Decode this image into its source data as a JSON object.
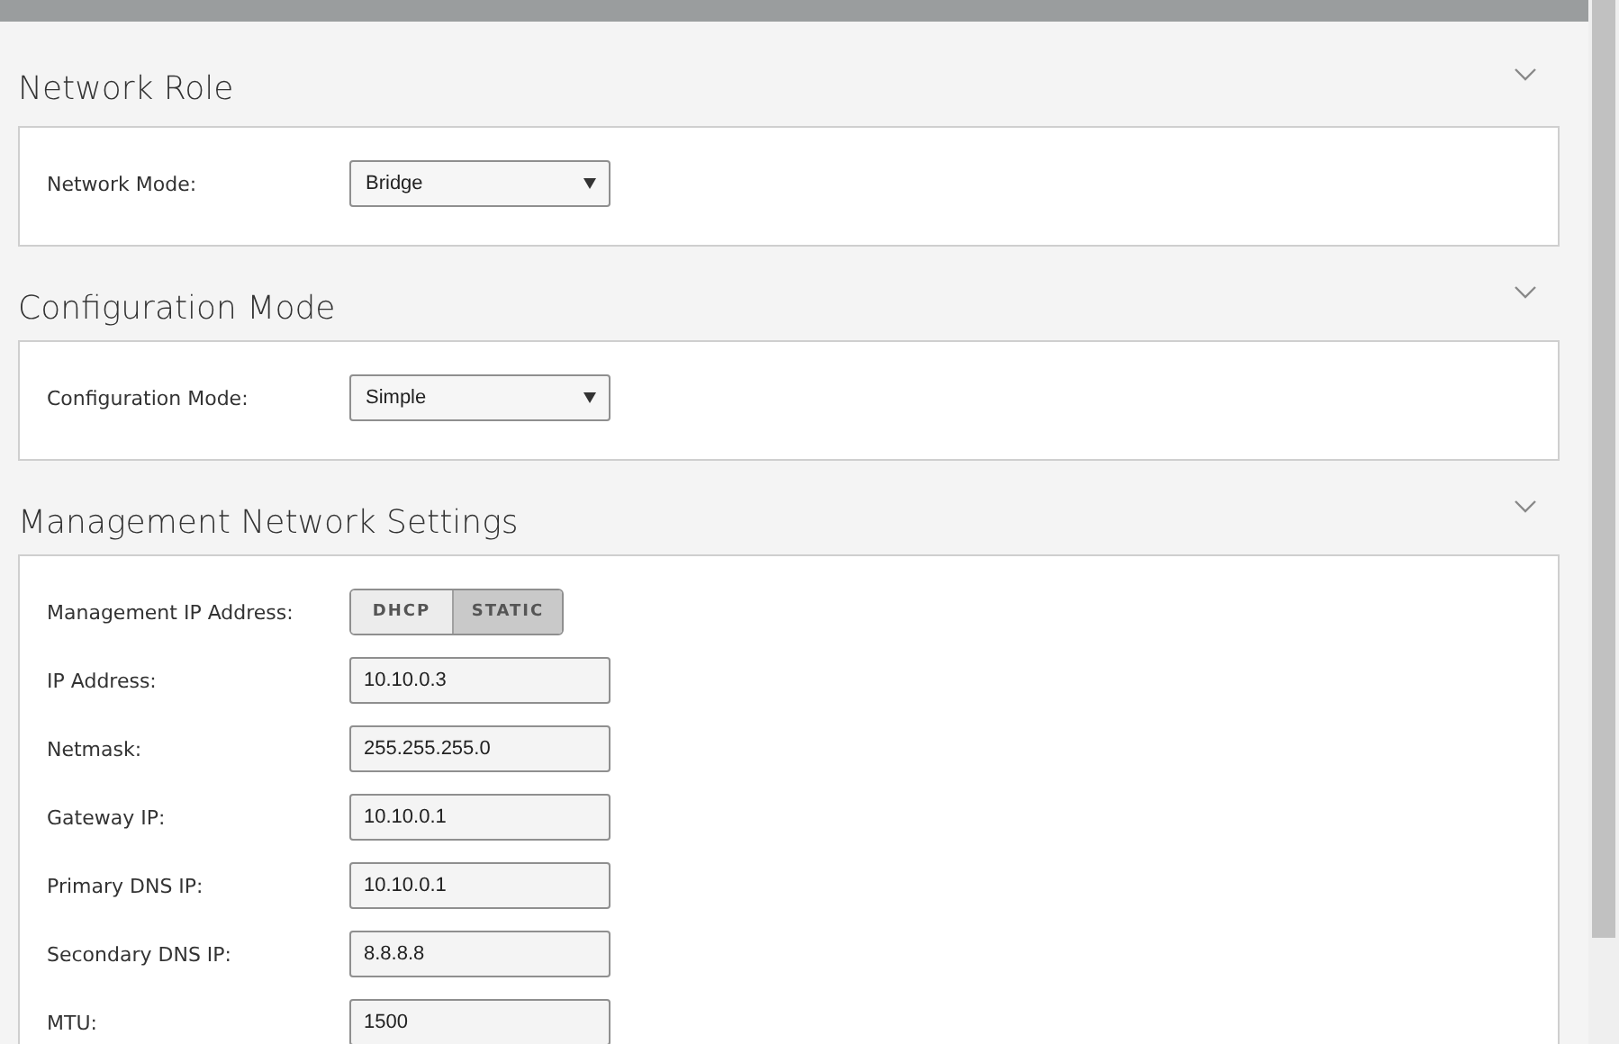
{
  "sections": [
    {
      "title": "Network Role",
      "rows": [
        {
          "kind": "select",
          "label": "Network Mode:",
          "value": "Bridge"
        }
      ]
    },
    {
      "title": "Configuration Mode",
      "rows": [
        {
          "kind": "select",
          "label": "Configuration Mode:",
          "value": "Simple"
        }
      ]
    },
    {
      "title": "Management Network Settings",
      "rows": [
        {
          "kind": "toggle",
          "label": "Management IP Address:",
          "options": [
            {
              "label": "DHCP",
              "selected": false
            },
            {
              "label": "STATIC",
              "selected": true
            }
          ]
        },
        {
          "kind": "text",
          "label": "IP Address:",
          "value": "10.10.0.3"
        },
        {
          "kind": "text",
          "label": "Netmask:",
          "value": "255.255.255.0"
        },
        {
          "kind": "text",
          "label": "Gateway IP:",
          "value": "10.10.0.1"
        },
        {
          "kind": "text",
          "label": "Primary DNS IP:",
          "value": "10.10.0.1"
        },
        {
          "kind": "text",
          "label": "Secondary DNS IP:",
          "value": "8.8.8.8"
        },
        {
          "kind": "text",
          "label": "MTU:",
          "value": "1500"
        }
      ]
    }
  ]
}
